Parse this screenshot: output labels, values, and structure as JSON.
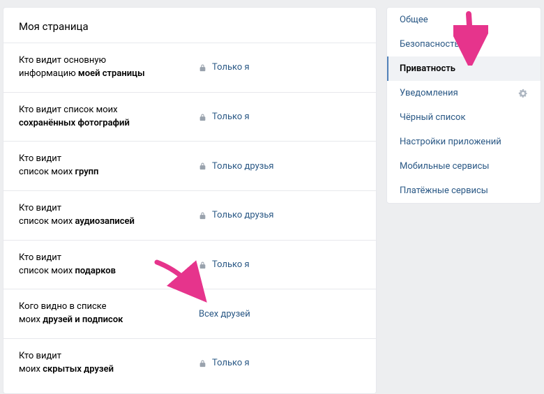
{
  "section_title": "Моя страница",
  "rows": [
    {
      "label_pre": "Кто видит основную<br>информацию ",
      "label_bold": "моей страницы",
      "value": "Только я",
      "locked": true
    },
    {
      "label_pre": "Кто видит список моих<br>",
      "label_bold": "сохранённых фотографий",
      "value": "Только я",
      "locked": true
    },
    {
      "label_pre": "Кто видит<br>список моих ",
      "label_bold": "групп",
      "value": "Только друзья",
      "locked": true
    },
    {
      "label_pre": "Кто видит<br>список моих ",
      "label_bold": "аудиозаписей",
      "value": "Только друзья",
      "locked": true
    },
    {
      "label_pre": "Кто видит<br>список моих ",
      "label_bold": "подарков",
      "value": "Только я",
      "locked": true
    },
    {
      "label_pre": "Кого видно в списке<br>моих ",
      "label_bold": "друзей и подписок",
      "value": "Всех друзей",
      "locked": false
    },
    {
      "label_pre": "Кто видит<br>моих ",
      "label_bold": "скрытых друзей",
      "value": "Только я",
      "locked": true
    }
  ],
  "sidebar": [
    {
      "label": "Общее",
      "active": false,
      "gear": false
    },
    {
      "label": "Безопасность",
      "active": false,
      "gear": false
    },
    {
      "label": "Приватность",
      "active": true,
      "gear": false
    },
    {
      "label": "Уведомления",
      "active": false,
      "gear": true
    },
    {
      "label": "Чёрный список",
      "active": false,
      "gear": false
    },
    {
      "label": "Настройки приложений",
      "active": false,
      "gear": false
    },
    {
      "label": "Мобильные сервисы",
      "active": false,
      "gear": false
    },
    {
      "label": "Платёжные сервисы",
      "active": false,
      "gear": false
    }
  ],
  "arrow_color": "#e6348c"
}
